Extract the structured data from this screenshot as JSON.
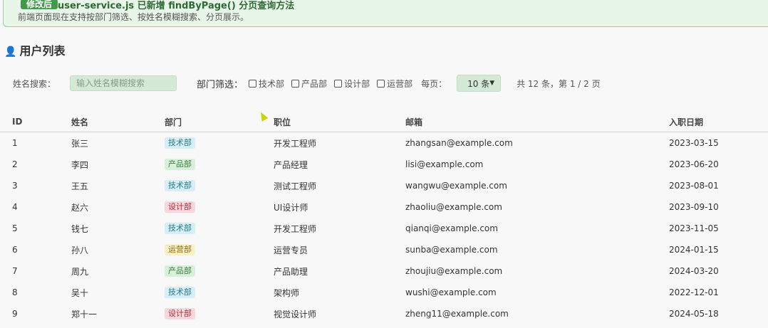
{
  "banner": {
    "badge": "修改后",
    "title": "user-service.js 已新增 findByPage() 分页查询方法",
    "subtitle": "前端页面现在支持按部门筛选、按姓名模糊搜索、分页展示。"
  },
  "page": {
    "title": "用户列表",
    "title_icon": "user-icon"
  },
  "filters": {
    "search_label": "姓名搜索：",
    "search_placeholder": "输入姓名模糊搜索",
    "search_value": "",
    "dept_label": "部门筛选：",
    "departments": [
      "技术部",
      "产品部",
      "设计部",
      "运营部"
    ],
    "per_page_label": "每页：",
    "per_page_value": "10 条",
    "total_text": "共 12 条，第 1 / 2 页"
  },
  "table": {
    "headers": [
      "ID",
      "姓名",
      "部门",
      "职位",
      "邮箱",
      "入职日期"
    ],
    "rows": [
      {
        "id": "1",
        "name": "张三",
        "dept": "技术部",
        "title": "开发工程师",
        "email": "zhangsan@example.com",
        "date": "2023-03-15"
      },
      {
        "id": "2",
        "name": "李四",
        "dept": "产品部",
        "title": "产品经理",
        "email": "lisi@example.com",
        "date": "2023-06-20"
      },
      {
        "id": "3",
        "name": "王五",
        "dept": "技术部",
        "title": "测试工程师",
        "email": "wangwu@example.com",
        "date": "2023-08-01"
      },
      {
        "id": "4",
        "name": "赵六",
        "dept": "设计部",
        "title": "UI设计师",
        "email": "zhaoliu@example.com",
        "date": "2023-09-10"
      },
      {
        "id": "5",
        "name": "钱七",
        "dept": "技术部",
        "title": "开发工程师",
        "email": "qianqi@example.com",
        "date": "2023-11-05"
      },
      {
        "id": "6",
        "name": "孙八",
        "dept": "运营部",
        "title": "运营专员",
        "email": "sunba@example.com",
        "date": "2024-01-15"
      },
      {
        "id": "7",
        "name": "周九",
        "dept": "产品部",
        "title": "产品助理",
        "email": "zhoujiu@example.com",
        "date": "2024-03-20"
      },
      {
        "id": "8",
        "name": "吴十",
        "dept": "技术部",
        "title": "架构师",
        "email": "wushi@example.com",
        "date": "2022-12-01"
      },
      {
        "id": "9",
        "name": "郑十一",
        "dept": "设计部",
        "title": "视觉设计师",
        "email": "zheng11@example.com",
        "date": "2024-05-18"
      }
    ]
  },
  "dept_colors": {
    "技术部": {
      "bg": "#d6eef5",
      "fg": "#2b7a8c"
    },
    "产品部": {
      "bg": "#d8efd9",
      "fg": "#3b7d42"
    },
    "设计部": {
      "bg": "#f8d7dc",
      "fg": "#a8323f"
    },
    "运营部": {
      "bg": "#fbf0c8",
      "fg": "#8a6d12"
    }
  }
}
